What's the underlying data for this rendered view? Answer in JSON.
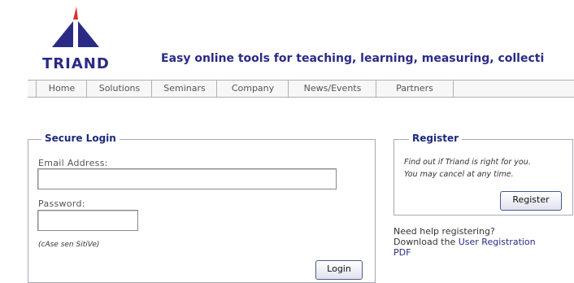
{
  "brand": {
    "logo_text": "TRIAND",
    "tagline": "Easy online tools for teaching, learning, measuring, collecti",
    "colors": {
      "primary": "#2b2b86",
      "accent": "#e03030"
    }
  },
  "nav": {
    "items": [
      {
        "label": "Home"
      },
      {
        "label": "Solutions"
      },
      {
        "label": "Seminars"
      },
      {
        "label": "Company"
      },
      {
        "label": "News/Events"
      },
      {
        "label": "Partners"
      }
    ]
  },
  "login": {
    "legend": "Secure Login",
    "email_label": "Email Address:",
    "email_value": "",
    "password_label": "Password:",
    "password_value": "",
    "case_note": "(cAse sen SitiVe)",
    "login_button": "Login"
  },
  "register": {
    "legend": "Register",
    "text_line1": "Find out if Triand is right for you.",
    "text_line2": "You may cancel at any time.",
    "button": "Register"
  },
  "help": {
    "line1": "Need help registering?",
    "line2_prefix": "Download the ",
    "link_text": "User Registration",
    "link_suffix": "PDF"
  }
}
